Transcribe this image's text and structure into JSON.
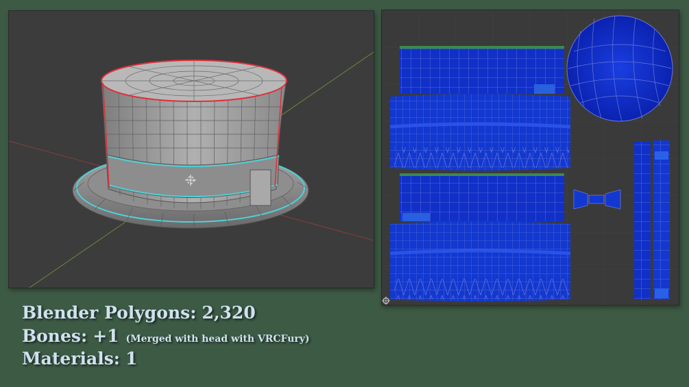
{
  "stats": {
    "polygons": {
      "label": "Blender Polygons:",
      "value": "2,320"
    },
    "bones": {
      "label": "Bones:",
      "value": "+1",
      "note": "(Merged with head with VRCFury)"
    },
    "materials": {
      "label": "Materials:",
      "value": "1"
    }
  },
  "colors": {
    "background": "#3d5a45",
    "viewport_bg": "#3c3c3c",
    "mesh_fill": "#9a9a9a",
    "seam_red": "#e0303a",
    "edge_cyan": "#4fd0d8",
    "uv_blue": "#1030c8",
    "text": "#cfe2ef"
  },
  "icons": {
    "viewport_origin": "3d-cursor-icon",
    "uv_corner": "uv-cursor-icon"
  }
}
